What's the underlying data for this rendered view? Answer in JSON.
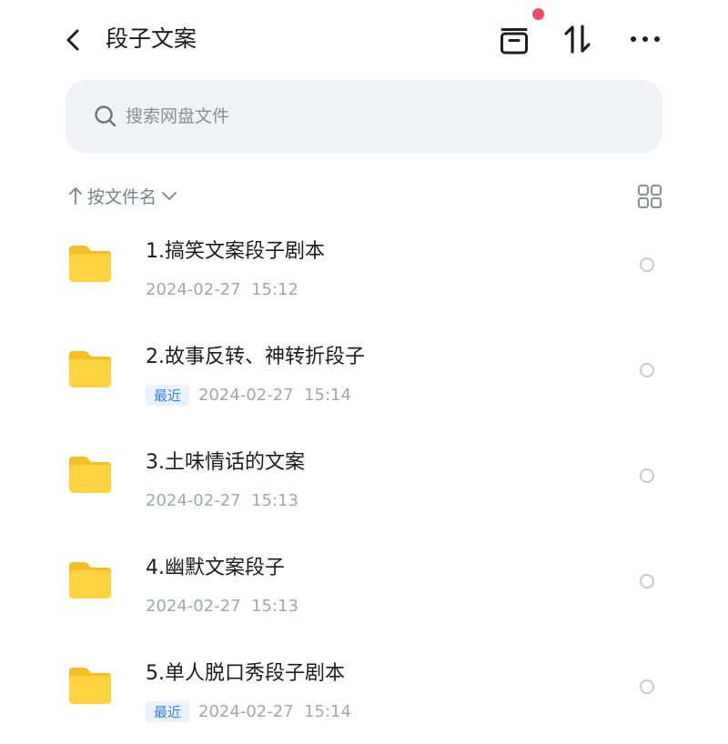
{
  "header": {
    "title": "段子文案",
    "back_icon": "chevron-left-icon",
    "archive_icon": "archive-box-icon",
    "sort_icon": "sort-arrows-icon",
    "more_icon": "more-horizontal-icon",
    "notification_dot_color": "#f14b6a"
  },
  "search": {
    "placeholder": "搜索网盘文件",
    "value": ""
  },
  "sort": {
    "label": "按文件名",
    "direction_icon": "arrow-up-icon",
    "dropdown_icon": "chevron-down-icon",
    "view_icon": "grid-view-icon"
  },
  "files": [
    {
      "name": "1.搞笑文案段子剧本",
      "tag": "",
      "date": "2024-02-27",
      "time": "15:12"
    },
    {
      "name": "2.故事反转、神转折段子",
      "tag": "最近",
      "date": "2024-02-27",
      "time": "15:14"
    },
    {
      "name": "3.土味情话的文案",
      "tag": "",
      "date": "2024-02-27",
      "time": "15:13"
    },
    {
      "name": "4.幽默文案段子",
      "tag": "",
      "date": "2024-02-27",
      "time": "15:13"
    },
    {
      "name": "5.单人脱口秀段子剧本",
      "tag": "最近",
      "date": "2024-02-27",
      "time": "15:14"
    }
  ],
  "colors": {
    "folder": "#ffd23f",
    "recent_tag_text": "#3a7de8",
    "recent_tag_bg": "#eaf2fd",
    "search_bg": "#f1f2f5"
  }
}
